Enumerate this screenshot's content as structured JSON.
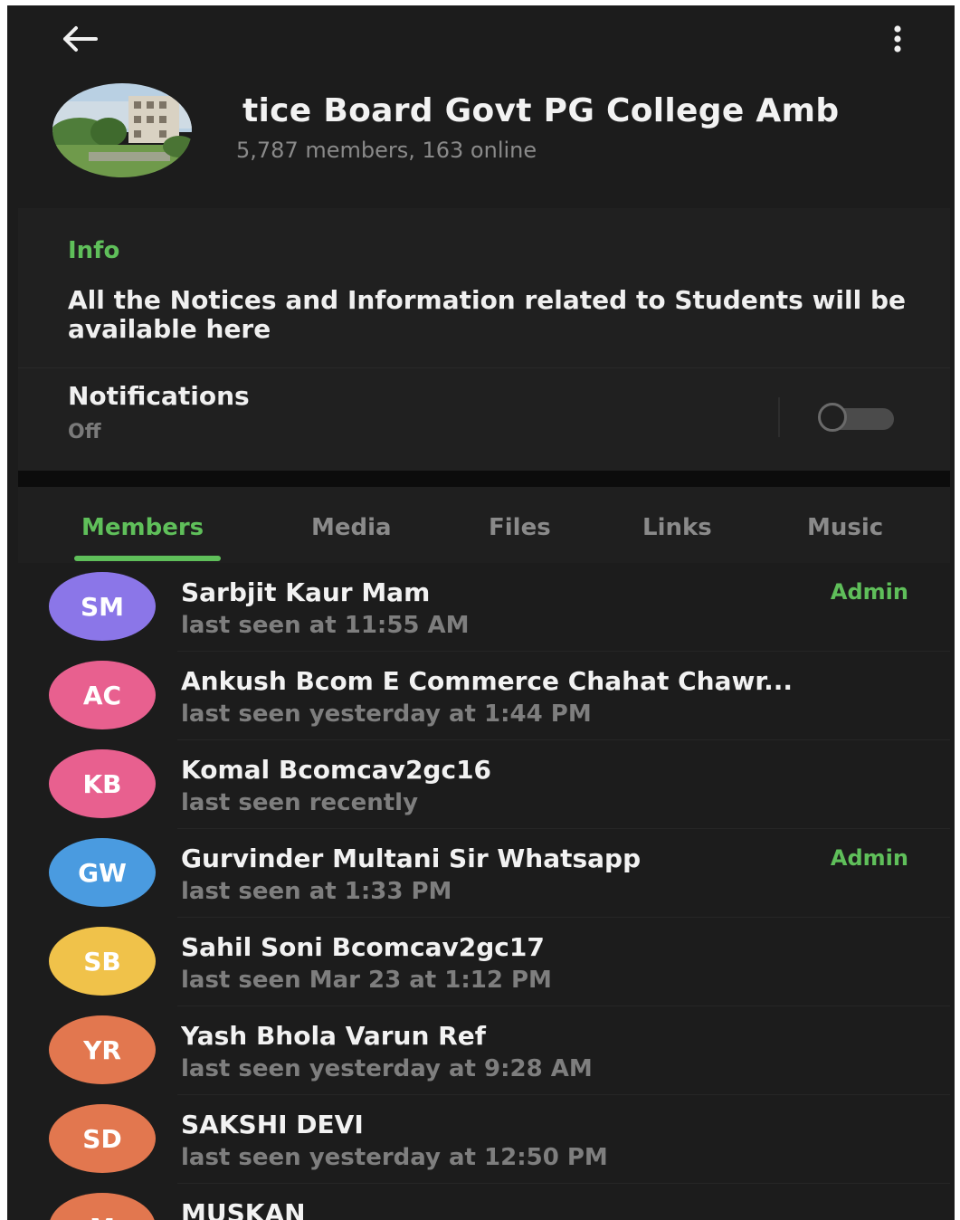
{
  "header": {
    "back_icon": "arrow-left-icon",
    "menu_icon": "more-vertical-icon",
    "title": "tice Board   Govt PG College Amb",
    "subtitle": "5,787 members, 163 online"
  },
  "info": {
    "label": "Info",
    "text": "All the Notices and Information related to Students will be available here"
  },
  "notifications": {
    "label": "Notifications",
    "status": "Off",
    "enabled": false
  },
  "tabs": [
    {
      "label": "Members",
      "active": true
    },
    {
      "label": "Media",
      "active": false
    },
    {
      "label": "Files",
      "active": false
    },
    {
      "label": "Links",
      "active": false
    },
    {
      "label": "Music",
      "active": false
    }
  ],
  "members": [
    {
      "initials": "SM",
      "name": "Sarbjit Kaur Mam",
      "status": "last seen at 11:55 AM",
      "role": "Admin",
      "color": "#8b76e8"
    },
    {
      "initials": "AC",
      "name": "Ankush Bcom E Commerce Chahat Chawr...",
      "status": "last seen yesterday at 1:44 PM",
      "role": "",
      "color": "#e8608f"
    },
    {
      "initials": "KB",
      "name": "Komal Bcomcav2gc16",
      "status": "last seen recently",
      "role": "",
      "color": "#e8608f"
    },
    {
      "initials": "GW",
      "name": "Gurvinder Multani Sir Whatsapp",
      "status": "last seen at 1:33 PM",
      "role": "Admin",
      "color": "#4a9be0"
    },
    {
      "initials": "SB",
      "name": "Sahil Soni Bcomcav2gc17",
      "status": "last seen Mar 23 at 1:12 PM",
      "role": "",
      "color": "#f0c24a"
    },
    {
      "initials": "YR",
      "name": "Yash Bhola Varun Ref",
      "status": "last seen yesterday at 9:28 AM",
      "role": "",
      "color": "#e2774f"
    },
    {
      "initials": "SD",
      "name": "SAKSHI DEVI",
      "status": "last seen yesterday at 12:50 PM",
      "role": "",
      "color": "#e2774f"
    },
    {
      "initials": "M",
      "name": "MUSKAN",
      "status": "",
      "role": "",
      "color": "#e2774f"
    }
  ],
  "colors": {
    "background": "#1c1c1c",
    "accent": "#5fbf5a",
    "primary_text": "#f2f2f2",
    "secondary_text": "#7e7e7e"
  }
}
